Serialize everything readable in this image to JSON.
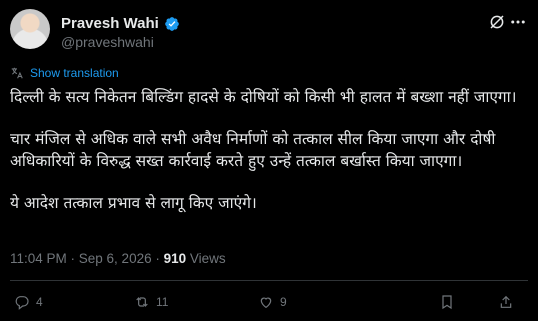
{
  "author": {
    "name": "Pravesh Wahi",
    "handle": "@praveshwahi"
  },
  "translate_label": "Show translation",
  "tweet": {
    "paragraphs": [
      "दिल्ली के सत्य निकेतन बिल्डिंग हादसे के दोषियों को किसी भी हालत में बख्शा नहीं जाएगा।",
      "चार मंजिल से अधिक वाले सभी अवैध निर्माणों को तत्काल सील किया जाएगा और दोषी अधिकारियों के विरुद्ध सख्त कार्रवाई करते हुए उन्हें तत्काल बर्खास्त किया जाएगा।",
      "ये आदेश तत्काल प्रभाव से लागू किए जाएंगे।"
    ]
  },
  "meta": {
    "timestamp": "11:04 PM · Sep 6, 2026 · ",
    "views_count": "910",
    "views_label": " Views"
  },
  "actions": {
    "replies": "4",
    "reposts": "11",
    "likes": "9"
  },
  "colors": {
    "background": "#000000",
    "accent": "#1d9bf0",
    "muted": "#71767b",
    "text": "#e7e9ea",
    "divider": "#2f3336"
  },
  "icons": [
    "verified-badge-icon",
    "grok-icon",
    "more-icon",
    "translate-icon",
    "reply-icon",
    "repost-icon",
    "like-icon",
    "bookmark-icon",
    "share-icon"
  ]
}
